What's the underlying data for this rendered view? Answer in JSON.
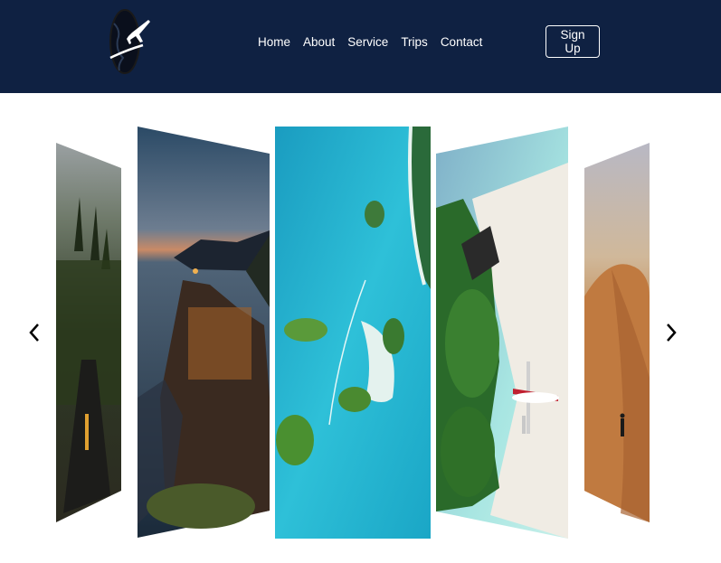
{
  "nav": {
    "links": [
      "Home",
      "About",
      "Service",
      "Trips",
      "Contact"
    ],
    "signup_label": "Sign Up"
  },
  "colors": {
    "navbar_bg": "#0f2142",
    "text": "#ffffff"
  },
  "carousel": {
    "prev_icon": "chevron-left-icon",
    "next_icon": "chevron-right-icon",
    "slides": [
      {
        "name": "forest-road"
      },
      {
        "name": "coastal-village-sunset"
      },
      {
        "name": "tropical-islands-aerial"
      },
      {
        "name": "beach-seaplane"
      },
      {
        "name": "desert-dune"
      }
    ]
  }
}
